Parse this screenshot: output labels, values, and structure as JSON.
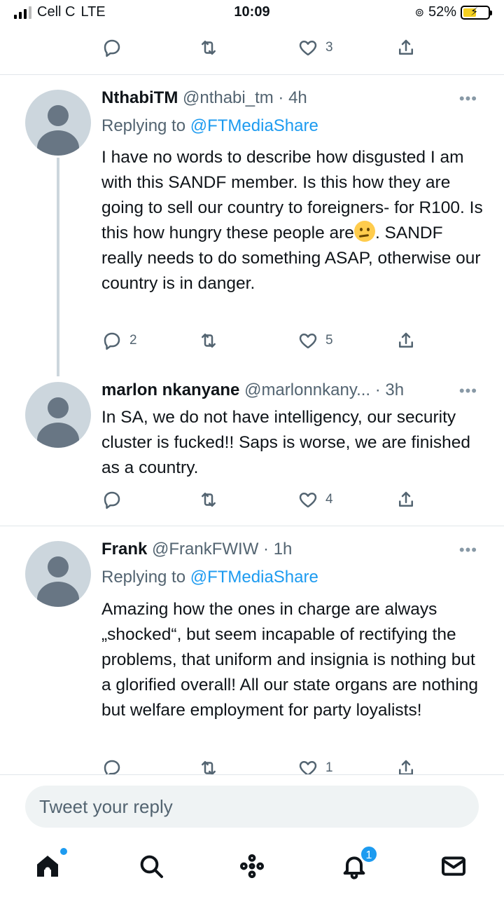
{
  "status_bar": {
    "carrier": "Cell C",
    "network": "LTE",
    "time": "10:09",
    "battery": "52%",
    "battery_level": 0.52
  },
  "prev_tweet": {
    "likes": "3"
  },
  "tweets": [
    {
      "name": "NthabiTM",
      "handle": "@nthabi_tm",
      "time": "· 4h",
      "replying_label": "Replying to",
      "replying_to": "@FTMediaShare",
      "text_before_emoji": "I have no words to describe how disgusted I am with this SANDF member. Is this how they are going to sell our country to foreigners- for R100. Is this how hungry these people are",
      "emoji": "thinking-face",
      "text_after_emoji": ". SANDF really needs to do something ASAP, otherwise our country is in danger.",
      "replies": "2",
      "likes": "5"
    },
    {
      "name": "marlon nkanyane",
      "handle": "@marlonnkany...",
      "time": "· 3h",
      "text": "In SA, we do not have intelligency, our security cluster is fucked!! Saps is worse, we are finished as a country.",
      "likes": "4"
    },
    {
      "name": "Frank",
      "handle": "@FrankFWIW",
      "time": "· 1h",
      "replying_label": "Replying to",
      "replying_to": "@FTMediaShare",
      "text": "Amazing how the ones in charge are always „shocked“, but seem incapable of rectifying the problems, that uniform and insignia is nothing but a glorified overall! All our state organs are nothing but welfare employment  for party loyalists!",
      "likes": "1"
    }
  ],
  "more_label": "•••",
  "reply_box": {
    "placeholder": "Tweet your reply"
  },
  "nav": {
    "notifications_badge": "1"
  },
  "icons": [
    "reply-icon",
    "retweet-icon",
    "like-icon",
    "share-icon",
    "home-icon",
    "search-icon",
    "spaces-icon",
    "notifications-icon",
    "messages-icon"
  ],
  "colors": {
    "accent": "#1d9bf0",
    "secondary_text": "#536471",
    "avatar_bg": "#ccd6dd"
  }
}
